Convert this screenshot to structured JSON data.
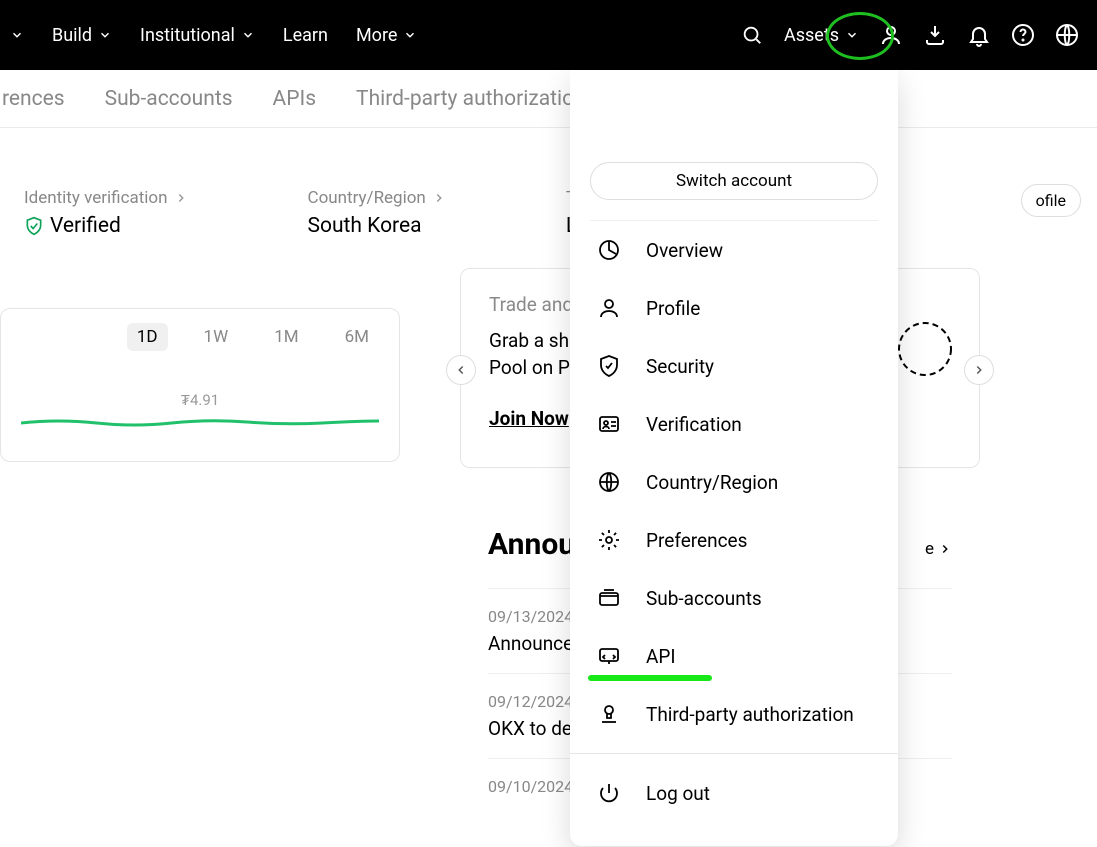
{
  "topnav": {
    "items": [
      "",
      "Build",
      "Institutional",
      "Learn",
      "More"
    ],
    "assets": "Assets"
  },
  "subnav": {
    "tabs": [
      "rences",
      "Sub-accounts",
      "APIs",
      "Third-party authorizatio"
    ]
  },
  "info": {
    "idv_label": "Identity verification",
    "idv_value": "Verified",
    "cr_label": "Country/Region",
    "cr_value": "South Korea",
    "tf_label": "Tradi",
    "tf_value": "Leve"
  },
  "profile_chip": "ofile",
  "chart": {
    "ranges": [
      "1D",
      "1W",
      "1M",
      "6M"
    ],
    "active_range": "1D",
    "price_label": "₮4.91"
  },
  "promo": {
    "title": "Trade and E",
    "line1": "Grab a shai",
    "line2": "Pool on Pre",
    "cta": "Join Now"
  },
  "annc": {
    "title": "Annou",
    "more_suffix": "e",
    "items": [
      {
        "date": "09/13/2024",
        "text": "Announcer USDC/EUR"
      },
      {
        "date": "09/12/2024",
        "text": "OKX to de"
      },
      {
        "date": "09/10/2024",
        "text": ""
      }
    ]
  },
  "dropdown": {
    "switch": "Switch account",
    "items": [
      {
        "icon": "pie",
        "label": "Overview"
      },
      {
        "icon": "profile",
        "label": "Profile"
      },
      {
        "icon": "shield",
        "label": "Security"
      },
      {
        "icon": "idcard",
        "label": "Verification"
      },
      {
        "icon": "globe",
        "label": "Country/Region"
      },
      {
        "icon": "gear",
        "label": "Preferences"
      },
      {
        "icon": "wallet",
        "label": "Sub-accounts"
      },
      {
        "icon": "api",
        "label": "API"
      },
      {
        "icon": "stamp",
        "label": "Third-party authorization"
      }
    ],
    "logout": "Log out"
  }
}
